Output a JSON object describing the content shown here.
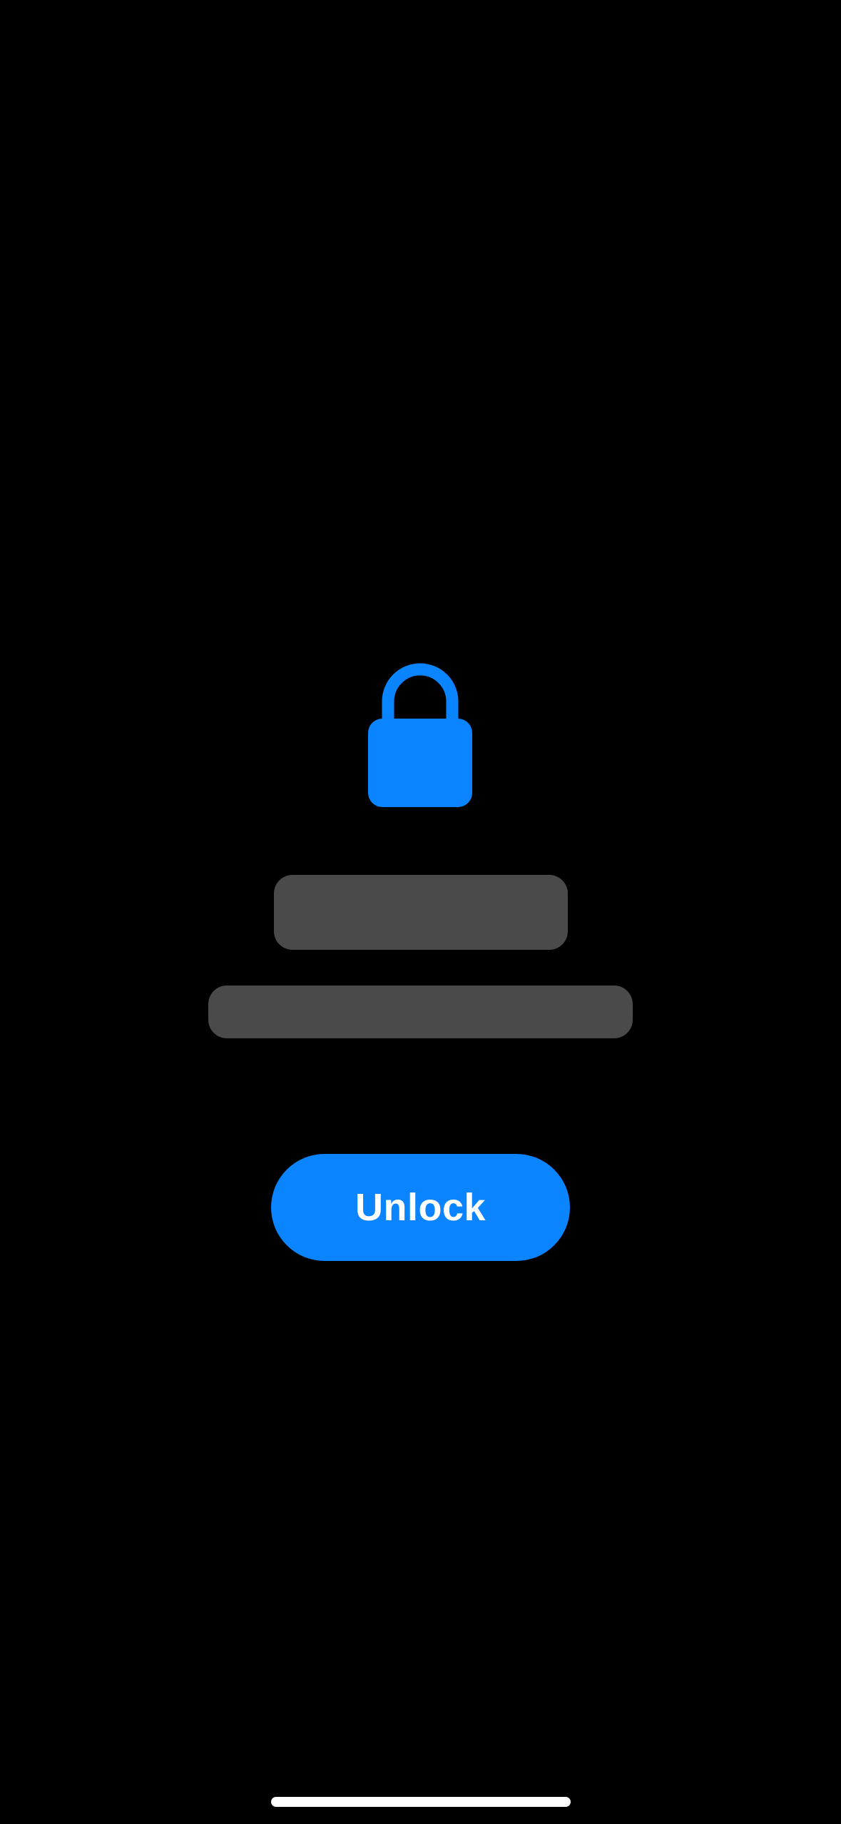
{
  "colors": {
    "background": "#000000",
    "accent": "#0A84FF",
    "placeholder": "#4A4A4A",
    "button_text": "#FFFFFF",
    "home_indicator": "#FFFFFF"
  },
  "lock_screen": {
    "icon": "lock-icon",
    "unlock_label": "Unlock"
  }
}
